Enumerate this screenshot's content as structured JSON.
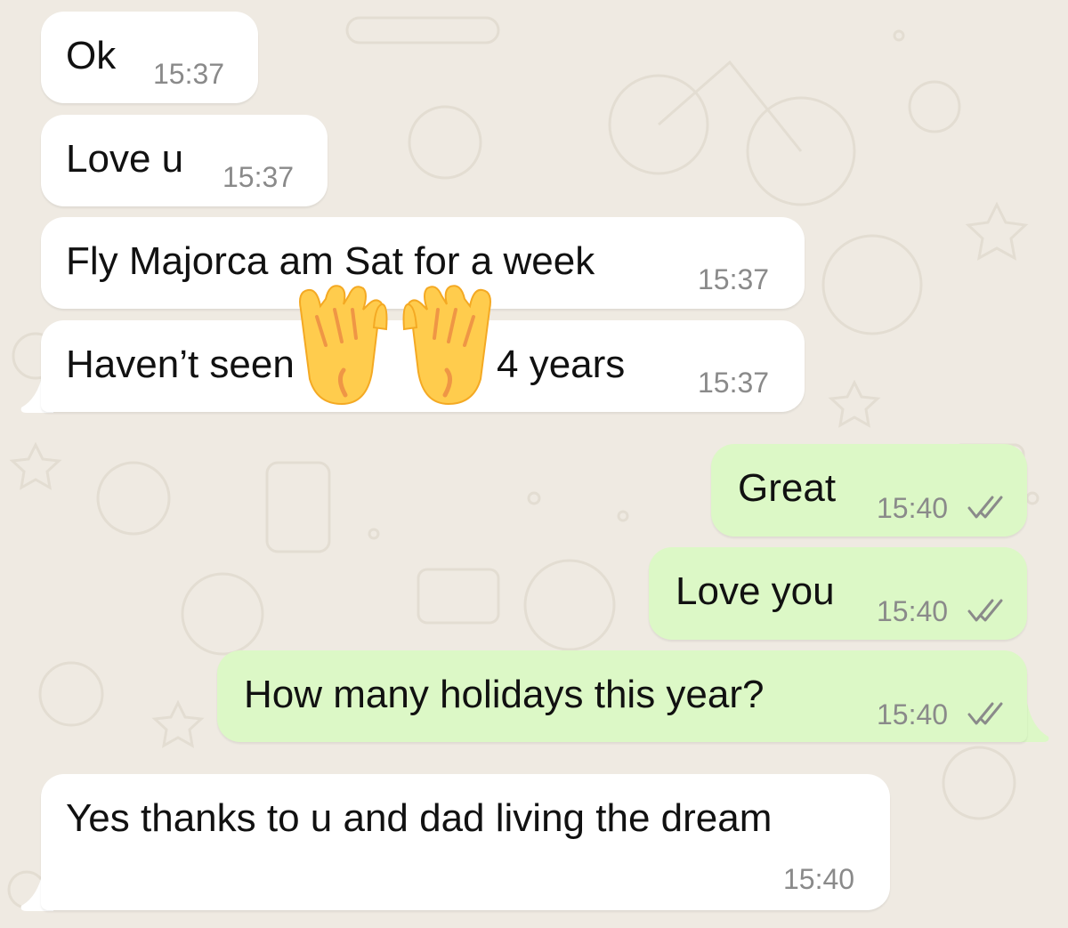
{
  "chat": {
    "messages": [
      {
        "text": "Ok",
        "time": "15:37",
        "direction": "incoming"
      },
      {
        "text": "Love u",
        "time": "15:37",
        "direction": "incoming"
      },
      {
        "text": "Fly Majorca am Sat for a week",
        "time": "15:37",
        "direction": "incoming"
      },
      {
        "text": "Haven’t seen",
        "text_after_emoji": "4 years",
        "time": "15:37",
        "direction": "incoming",
        "overlay_emoji": "raising-hands-icon"
      },
      {
        "text": "Great",
        "time": "15:40",
        "direction": "outgoing",
        "status": "read-ticks-icon"
      },
      {
        "text": "Love you",
        "time": "15:40",
        "direction": "outgoing",
        "status": "read-ticks-icon"
      },
      {
        "text": "How many holidays this year?",
        "time": "15:40",
        "direction": "outgoing",
        "status": "read-ticks-icon"
      },
      {
        "text": "Yes thanks to u and dad living the dream",
        "time": "15:40",
        "direction": "incoming"
      }
    ]
  },
  "colors": {
    "background": "#efeae2",
    "incoming_bubble": "#ffffff",
    "outgoing_bubble": "#dcf8c6",
    "timestamp": "#8a8a8a",
    "ticks": "#8a8a8a"
  }
}
